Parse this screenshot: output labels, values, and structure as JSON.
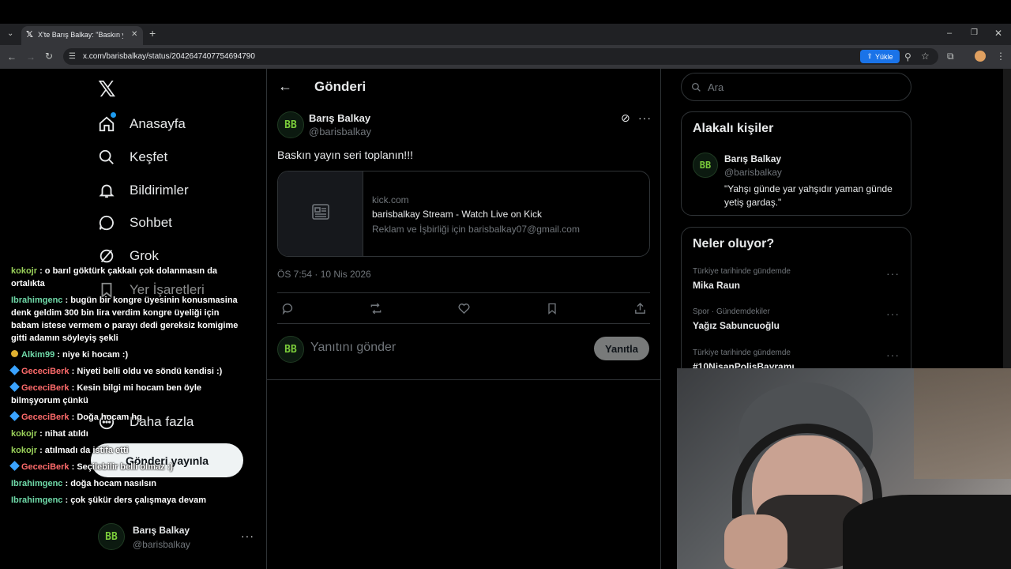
{
  "browser": {
    "tab_title": "X'te Barış Balkay: \"Baskın yayın",
    "url": "x.com/barisbalkay/status/2042647407754694790",
    "upload_label": "Yükle"
  },
  "nav": {
    "items": [
      {
        "label": "Anasayfa",
        "icon": "home-icon"
      },
      {
        "label": "Keşfet",
        "icon": "search-icon"
      },
      {
        "label": "Bildirimler",
        "icon": "bell-icon"
      },
      {
        "label": "Sohbet",
        "icon": "chat-bubble-icon"
      },
      {
        "label": "Grok",
        "icon": "grok-icon"
      },
      {
        "label": "Yer İşaretleri",
        "icon": "bookmark-icon"
      },
      {
        "label": "Daha fazla",
        "icon": "more-circle-icon"
      }
    ],
    "post_button": "Gönderi yayınla",
    "account_name": "Barış Balkay",
    "account_handle": "@barisbalkay"
  },
  "chat": [
    {
      "user": "kokojr",
      "badge": "",
      "text": ": o barıl göktürk çakkalı çok dolanmasın da ortalıkta"
    },
    {
      "user": "Ibrahimgenc",
      "badge": "",
      "text": ": bugün bir kongre üyesinin konusmasina denk geldim 300 bin lira verdim kongre üyeliği için babam istese vermem o parayı dedi gereksiz komigime gitti adamın söyleyiş şekli"
    },
    {
      "user": "Alkim99",
      "badge": "gold",
      "text": ": niye ki hocam :)"
    },
    {
      "user": "GececiBerk",
      "badge": "cube",
      "text": ": Niyeti belli oldu ve söndü kendisi :)"
    },
    {
      "user": "GececiBerk",
      "badge": "cube",
      "text": ": Kesin bilgi mi hocam ben öyle bilmşyorum çünkü"
    },
    {
      "user": "GececiBerk",
      "badge": "cube",
      "text": ": Doğa hocam hg"
    },
    {
      "user": "kokojr",
      "badge": "",
      "text": ": nihat atıldı"
    },
    {
      "user": "kokojr",
      "badge": "",
      "text": ": atılmadı da istifa etti"
    },
    {
      "user": "GececiBerk",
      "badge": "cube",
      "text": ": Seçilebilir belli olmaz :)"
    },
    {
      "user": "Ibrahimgenc",
      "badge": "",
      "text": ": doğa hocam nasılsın"
    },
    {
      "user": "Ibrahimgenc",
      "badge": "",
      "text": ": çok şükür ders çalışmaya devam"
    }
  ],
  "main": {
    "header_title": "Gönderi",
    "author_name": "Barış Balkay",
    "author_handle": "@barisbalkay",
    "tweet_text": "Baskın yayın seri toplanın!!!",
    "card": {
      "domain": "kick.com",
      "title": "barisbalkay Stream - Watch Live on Kick",
      "description": "Reklam ve İşbirliği için barisbalkay07@gmail.com"
    },
    "timestamp": "ÖS 7:54 · 10 Nis 2026",
    "reply_placeholder": "Yanıtını gönder",
    "reply_button": "Yanıtla"
  },
  "sidebar": {
    "search_placeholder": "Ara",
    "relevant_title": "Alakalı kişiler",
    "relevant_name": "Barış Balkay",
    "relevant_handle": "@barisbalkay",
    "relevant_bio": "\"Yahşı günde yar yahşıdır yaman günde yetiş gardaş.\"",
    "trends_title": "Neler oluyor?",
    "trends": [
      {
        "meta": "Türkiye tarihinde gündemde",
        "title": "Mika Raun"
      },
      {
        "meta": "Spor · Gündemdekiler",
        "title": "Yağız Sabuncuoğlu"
      },
      {
        "meta": "Türkiye tarihinde gündemde",
        "title": "#10NisanPolisBayramı"
      }
    ]
  },
  "colors": {
    "background": "#000000",
    "border": "#2f3336",
    "muted_text": "#71767b",
    "accent_green": "#7acb3a",
    "upload_blue": "#1a73e8"
  }
}
